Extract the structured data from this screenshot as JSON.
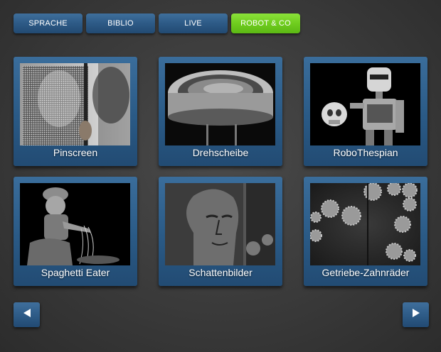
{
  "tabs": [
    {
      "label": "SPRACHE",
      "active": false
    },
    {
      "label": "BIBLIO",
      "active": false
    },
    {
      "label": "LIVE",
      "active": false
    },
    {
      "label": "ROBOT & CO",
      "active": true
    }
  ],
  "items": [
    {
      "label": "Pinscreen",
      "image": "pinscreen-photo"
    },
    {
      "label": "Drehscheibe",
      "image": "turntable-photo"
    },
    {
      "label": "RoboThespian",
      "image": "robot-photo"
    },
    {
      "label": "Spaghetti Eater",
      "image": "puppet-photo"
    },
    {
      "label": "Schattenbilder",
      "image": "shadow-face-photo"
    },
    {
      "label": "Getriebe-Zahnräder",
      "image": "gears-photo"
    }
  ],
  "navigation": {
    "prev_icon": "arrow-left-icon",
    "next_icon": "arrow-right-icon"
  },
  "colors": {
    "tab_blue": "#2d5a86",
    "tab_active_green": "#6fcd1e",
    "background": "#3a3a3a"
  }
}
